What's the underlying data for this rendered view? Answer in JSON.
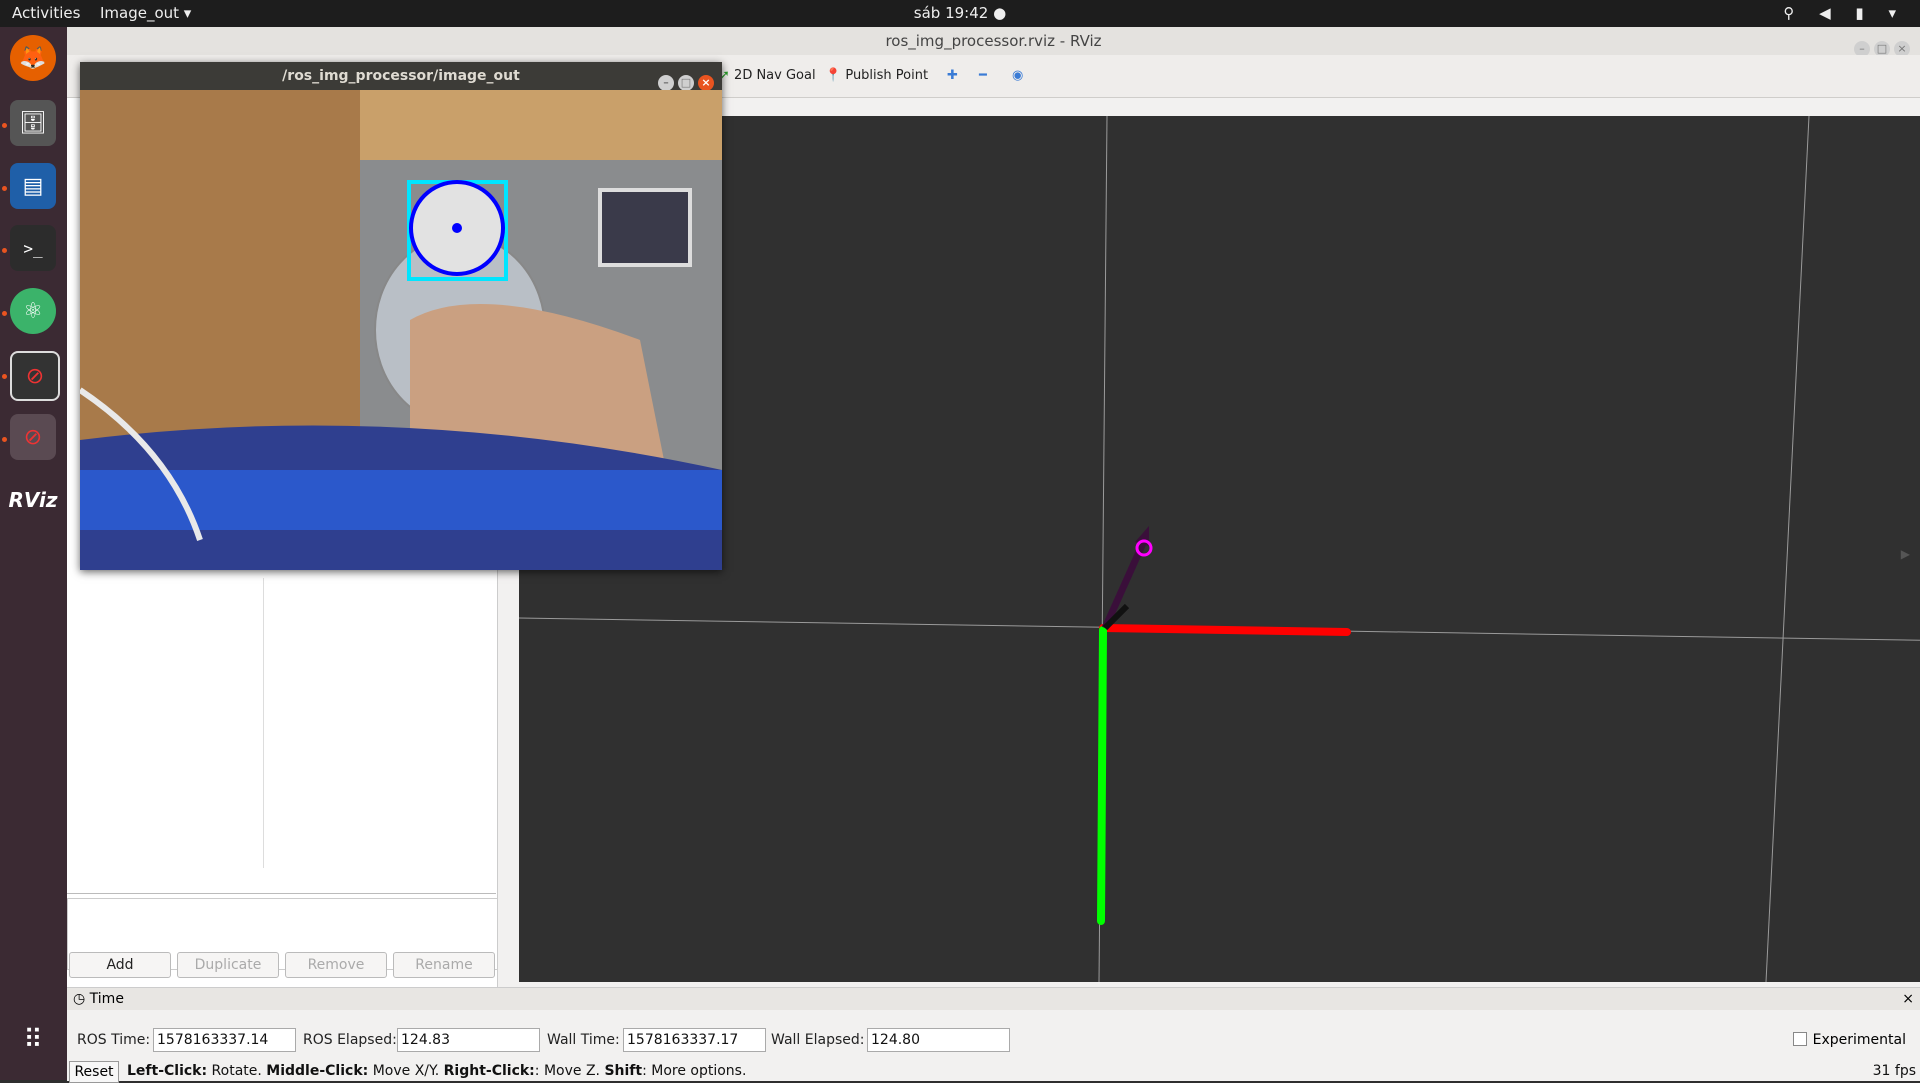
{
  "topbar": {
    "activities": "Activities",
    "app_menu": "Image_out ▾",
    "clock": "sáb 19:42 ●",
    "tray_icons": [
      "network-icon",
      "volume-icon",
      "battery-icon",
      "menu-arrow-icon"
    ]
  },
  "dock": {
    "items": [
      "firefox-icon",
      "files-icon",
      "writer-icon",
      "terminal-icon",
      "atom-icon",
      "app-icon",
      "app-icon",
      "rviz-icon"
    ],
    "rviz_label": "RViz",
    "grid_icon": "apps-grid-icon"
  },
  "rviz": {
    "title": "ros_img_processor.rviz - RViz",
    "toolbar": {
      "nav_goal": "2D Nav Goal",
      "publish_point": "Publish Point"
    },
    "panel_buttons": {
      "add": "Add",
      "duplicate": "Duplicate",
      "remove": "Remove",
      "rename": "Rename"
    },
    "time_panel": {
      "title": "Time",
      "ros_time_label": "ROS Time:",
      "ros_time": "1578163337.14",
      "ros_elapsed_label": "ROS Elapsed:",
      "ros_elapsed": "124.83",
      "wall_time_label": "Wall Time:",
      "wall_time": "1578163337.17",
      "wall_elapsed_label": "Wall Elapsed:",
      "wall_elapsed": "124.80",
      "experimental": "Experimental"
    },
    "status": {
      "reset": "Reset",
      "lc": "Left-Click:",
      "lc_t": " Rotate. ",
      "mc": "Middle-Click:",
      "mc_t": " Move X/Y. ",
      "rc": "Right-Click:",
      "rc_t": ": Move Z. ",
      "sh": "Shift",
      "sh_t": ": More options.",
      "fps": "31 fps"
    }
  },
  "image_window": {
    "title": "/ros_img_processor/image_out"
  },
  "colors": {
    "x_axis": "#ff0000",
    "y_axis": "#00ff00",
    "arrow": "#3a0f3a",
    "detect_box": "#00e5ff",
    "detect_circle": "#0000ff"
  }
}
